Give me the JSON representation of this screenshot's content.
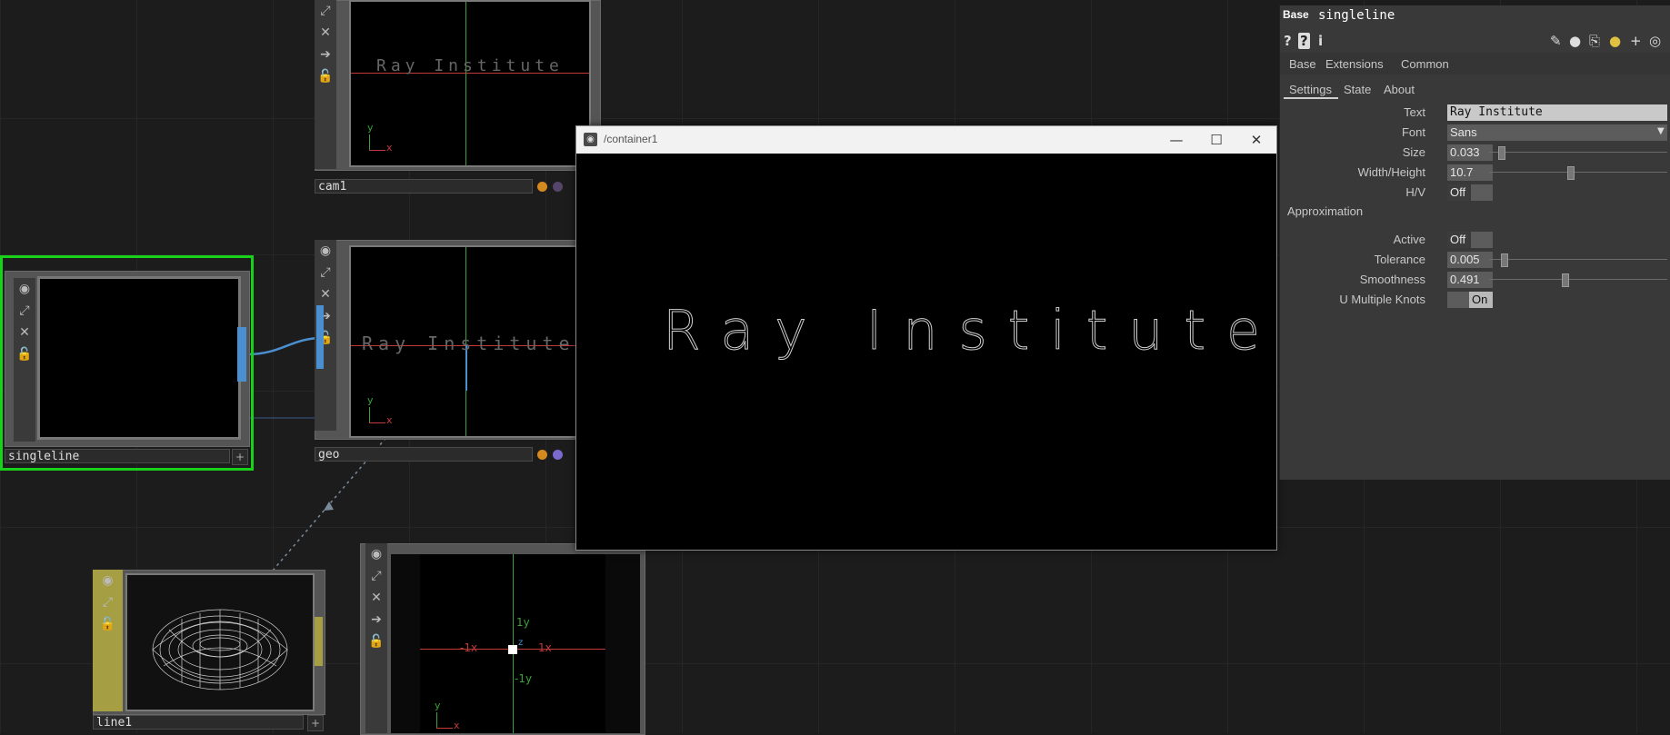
{
  "nodes": {
    "cam1": {
      "label": "cam1",
      "overlay_text": "Ray Institute"
    },
    "geo": {
      "label": "geo",
      "overlay_text": "Ray Institute"
    },
    "singleline": {
      "label": "singleline"
    },
    "line1": {
      "label": "line1"
    },
    "axis_viewer": {
      "pos_y": "1y",
      "neg_y": "-1y",
      "pos_x": "1x",
      "neg_x": "-1x",
      "z": "z"
    },
    "axis_gizmo": {
      "x": "x",
      "y": "y"
    }
  },
  "window": {
    "title": "/container1",
    "text": "Ray Institute",
    "minimize": "—",
    "maximize": "☐",
    "close": "✕"
  },
  "panel": {
    "type": "Base",
    "name": "singleline",
    "tabs_top": [
      "Base",
      "Extensions",
      "Common"
    ],
    "tabs_sub": [
      "Settings",
      "State",
      "About"
    ],
    "params": {
      "text": {
        "label": "Text",
        "value": "Ray Institute"
      },
      "font": {
        "label": "Font",
        "value": "Sans"
      },
      "size": {
        "label": "Size",
        "value": "0.033"
      },
      "width_height": {
        "label": "Width/Height",
        "value": "10.7"
      },
      "hv": {
        "label": "H/V",
        "value": "Off"
      },
      "section": "Approximation",
      "active": {
        "label": "Active",
        "value": "Off"
      },
      "tolerance": {
        "label": "Tolerance",
        "value": "0.005"
      },
      "smoothness": {
        "label": "Smoothness",
        "value": "0.491"
      },
      "u_multiple_knots": {
        "label": "U Multiple Knots",
        "value": "On"
      }
    },
    "slider_levels": {
      "size": 0.05,
      "width_height": 0.45,
      "tolerance": 0.07,
      "smoothness": 0.42
    }
  },
  "colors": {
    "selection": "#17d11a",
    "grid_red": "#c23a3a",
    "grid_green": "#3aa13a",
    "wire_blue": "#4a8fd0",
    "dat_yellow": "#a59e43"
  }
}
